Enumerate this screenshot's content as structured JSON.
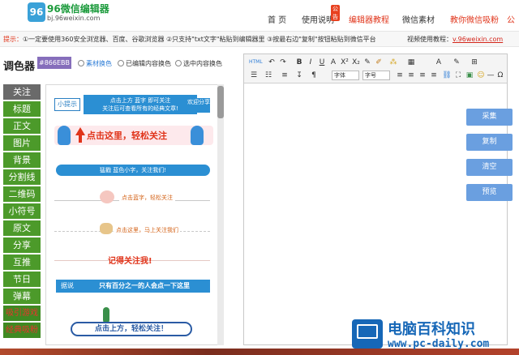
{
  "header": {
    "logo_mark": "96",
    "logo_title": "96微信编辑器",
    "logo_url": "bj.96weixin.com",
    "nav": [
      {
        "label": "首 页",
        "red": false
      },
      {
        "label": "使用说明",
        "red": false
      },
      {
        "label": "编辑器教程",
        "red": true,
        "badge": "公告"
      },
      {
        "label": "微信素材",
        "red": false
      },
      {
        "label": "教你微信吸粉",
        "red": true
      },
      {
        "label": "公",
        "red": true
      }
    ]
  },
  "tipbar": {
    "label": "提示：",
    "text": "①一定要使用360安全浏览器、百度、谷歌浏览器 ②只支持\"txt文字\"粘贴到编辑器里 ③按最右边\"复制\"按钮粘贴到微信平台",
    "video_label": "视频使用教程：",
    "video_link": "v.96weixin.com"
  },
  "color_picker": {
    "label": "调色器",
    "value": "#866EBB",
    "swatch_color": "#866ebb",
    "options": [
      "素材换色",
      "已编辑内容换色",
      "选中内容换色"
    ]
  },
  "categories": [
    {
      "label": "关注",
      "active": true
    },
    {
      "label": "标题"
    },
    {
      "label": "正文"
    },
    {
      "label": "图片"
    },
    {
      "label": "背景"
    },
    {
      "label": "分割线"
    },
    {
      "label": "二维码"
    },
    {
      "label": "小符号"
    },
    {
      "label": "原文"
    },
    {
      "label": "分享"
    },
    {
      "label": "互推"
    },
    {
      "label": "节日"
    },
    {
      "label": "弹幕"
    },
    {
      "label": "吸引游戏",
      "red": true
    },
    {
      "label": "经典吸粉",
      "red": true
    }
  ],
  "templates": {
    "t1": {
      "tag": "小提示",
      "line1": "点击上方 蓝字 即可关注",
      "line2": "关注后可查看所有的经典文章!",
      "right": "欢迎分享"
    },
    "t2": {
      "text": "点击这里，轻松关注"
    },
    "t3": {
      "text": "猛戳  蓝色小字，关注我们!"
    },
    "t4": {
      "text": "点击蓝字，轻松关注"
    },
    "t5": {
      "text": "点击这里，马上关注我们"
    },
    "t6": {
      "text": "记得关注我!"
    },
    "t7": {
      "tag": "据说",
      "text": "只有百分之一的人会点一下这里"
    },
    "t8": {
      "text": "点击上方，轻松关注！"
    }
  },
  "editor": {
    "toolbar_row1": [
      "HTML",
      "↶",
      "↷",
      "B",
      "I",
      "U",
      "A",
      "X²",
      "X₂",
      "✎",
      "✐",
      "⁂",
      "▦",
      "A",
      "✎",
      "⊞"
    ],
    "toolbar_row2": [
      "☰",
      "☷",
      "≡",
      "↧",
      "¶",
      "字体",
      "字号",
      "≡",
      "≡",
      "≡",
      "≡",
      "⛓",
      "⛶",
      "▣",
      "☺",
      "—",
      "Ω",
      "▤"
    ],
    "font_select": "字体",
    "size_select": "字号"
  },
  "side_buttons": [
    "采集",
    "复制",
    "清空",
    "预览"
  ],
  "watermark": {
    "title": "电脑百科知识",
    "url": "www.pc-daily.com"
  }
}
